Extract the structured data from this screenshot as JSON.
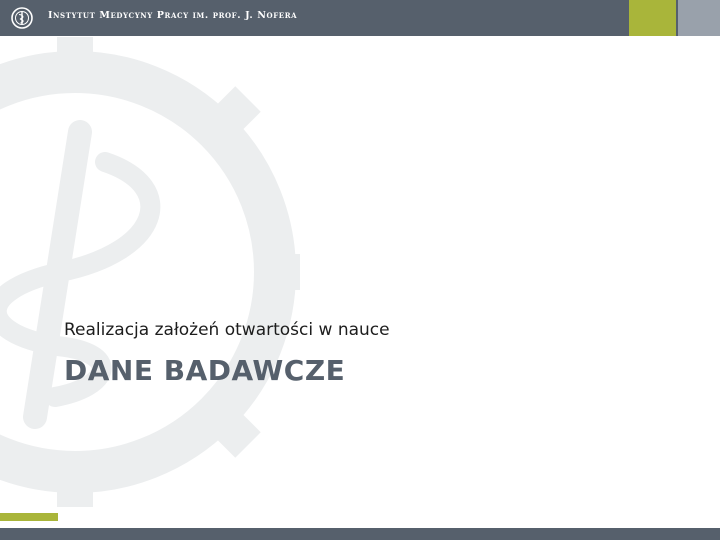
{
  "header": {
    "title": "Instytut Medycyny Pracy im. prof. J. Nofera",
    "logo_icon": "institute-logo-icon"
  },
  "slide": {
    "subtitle": "Realizacja założeń otwartości w nauce",
    "title": "DANE BADAWCZE",
    "watermark_icon": "gear-staff-watermark-icon"
  },
  "colors": {
    "header_bg": "#56606c",
    "accent_green": "#a9b53a",
    "accent_grey": "#99a1ab",
    "title_text": "#56606c",
    "watermark": "#eceeef"
  }
}
